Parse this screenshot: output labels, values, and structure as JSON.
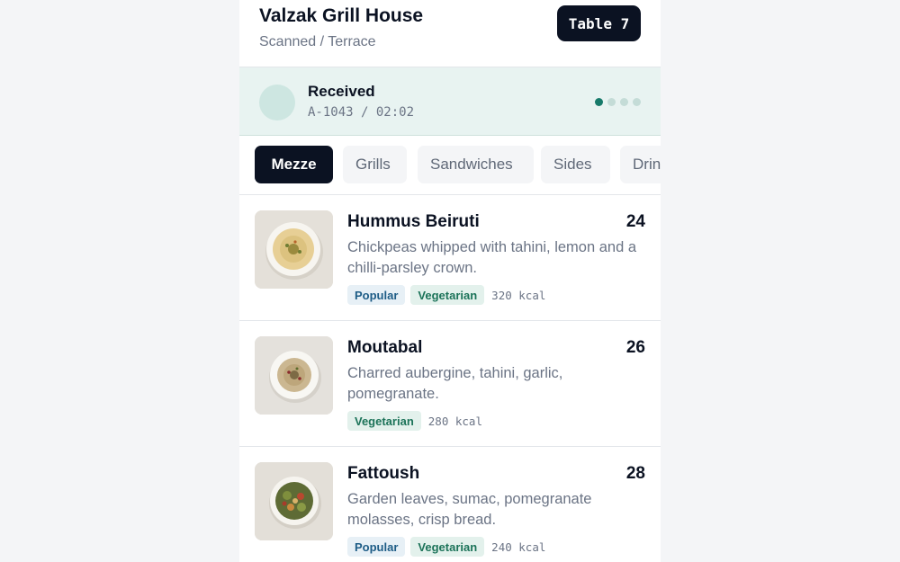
{
  "header": {
    "restaurant": "Valzak Grill House",
    "location": "Scanned / Terrace",
    "table": "Table 7"
  },
  "status": {
    "title": "Received",
    "meta": "A-1043 / 02:02",
    "progress_fraction": 0.25
  },
  "tabs": [
    {
      "label": "Mezze",
      "active": true
    },
    {
      "label": "Grills"
    },
    {
      "label": "Sandwiches"
    },
    {
      "label": "Sides"
    },
    {
      "label": "Drinks"
    }
  ],
  "menu": [
    {
      "name": "Hummus Beiruti",
      "price": "24",
      "desc": "Chickpeas whipped with tahini, lemon and a chilli-parsley crown.",
      "tags": [
        "Popular",
        "Vegetarian"
      ],
      "kcal": "320 kcal",
      "image": "hummus-bowl"
    },
    {
      "name": "Moutabal",
      "price": "26",
      "desc": "Charred aubergine, tahini, garlic, pomegranate.",
      "tags": [
        "Vegetarian"
      ],
      "kcal": "280 kcal",
      "image": "moutabal-bowl"
    },
    {
      "name": "Fattoush",
      "price": "28",
      "desc": "Garden leaves, sumac, pomegranate molasses, crisp bread.",
      "tags": [
        "Popular",
        "Vegetarian"
      ],
      "kcal": "240 kcal",
      "image": "fattoush-bowl"
    }
  ],
  "colors": {
    "ink": "#0b1222",
    "accent": "#177a6a",
    "status_bg": "#e8f3f1"
  }
}
